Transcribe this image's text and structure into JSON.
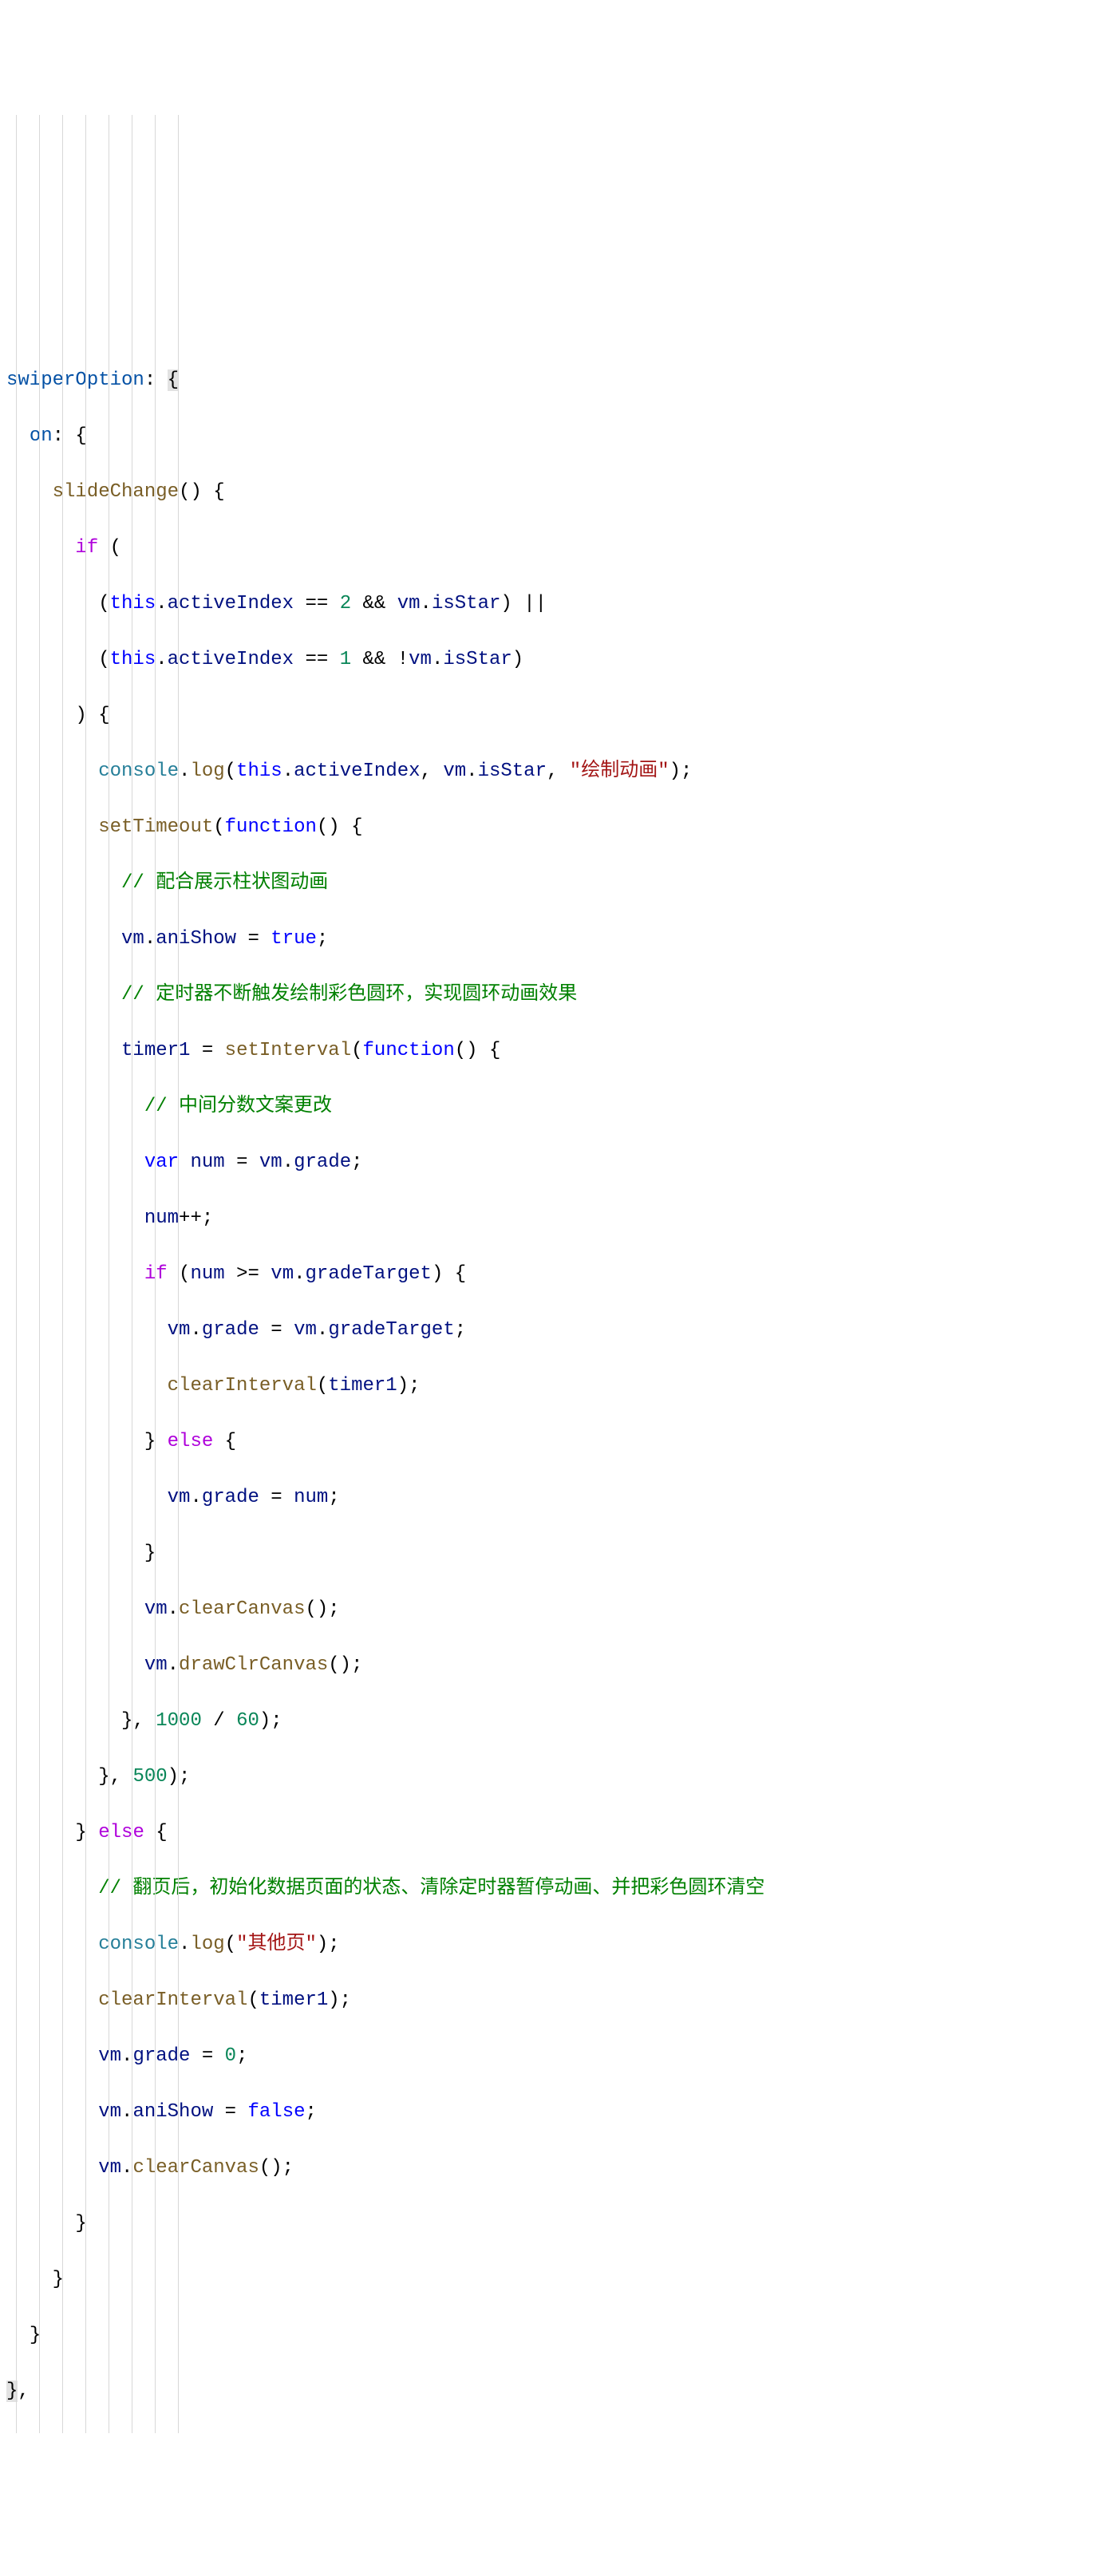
{
  "code": {
    "t_swiperOption": "swiperOption",
    "t_on": "on",
    "t_slideChange": "slideChange",
    "t_if": "if",
    "t_this1": "this",
    "t_activeIndex1": "activeIndex",
    "t_eq1": "==",
    "t_2": "2",
    "t_and1": "&&",
    "t_vm1": "vm",
    "t_isStar1": "isStar",
    "t_or": "||",
    "t_this2": "this",
    "t_activeIndex2": "activeIndex",
    "t_eq2": "==",
    "t_1": "1",
    "t_and2": "&&",
    "t_not": "!",
    "t_vm2": "vm",
    "t_isStar2": "isStar",
    "t_console1": "console",
    "t_log1": "log",
    "t_this3": "this",
    "t_activeIndex3": "activeIndex",
    "t_vm3": "vm",
    "t_isStar3": "isStar",
    "t_strDraw": "\"绘制动画\"",
    "t_setTimeout": "setTimeout",
    "t_function1": "function",
    "t_com1": "// 配合展示柱状图动画",
    "t_vm4": "vm",
    "t_aniShow1": "aniShow",
    "t_true": "true",
    "t_com2": "// 定时器不断触发绘制彩色圆环，实现圆环动画效果",
    "t_timer1a": "timer1",
    "t_setInterval": "setInterval",
    "t_function2": "function",
    "t_com3": "// 中间分数文案更改",
    "t_var": "var",
    "t_numDecl": "num",
    "t_vm5": "vm",
    "t_grade1": "grade",
    "t_numInc": "num",
    "t_pp": "++",
    "t_if2": "if",
    "t_num2": "num",
    "t_gte": ">=",
    "t_vm6": "vm",
    "t_gradeTarget1": "gradeTarget",
    "t_vm7": "vm",
    "t_grade2": "grade",
    "t_vm8": "vm",
    "t_gradeTarget2": "gradeTarget",
    "t_clearInterval1": "clearInterval",
    "t_timer1b": "timer1",
    "t_else1": "else",
    "t_vm9": "vm",
    "t_grade3": "grade",
    "t_num3": "num",
    "t_vm10": "vm",
    "t_clearCanvas1": "clearCanvas",
    "t_vm11": "vm",
    "t_drawClrCanvas": "drawClrCanvas",
    "t_1000": "1000",
    "t_div": "/",
    "t_60": "60",
    "t_500": "500",
    "t_else2": "else",
    "t_com4": "// 翻页后，初始化数据页面的状态、清除定时器暂停动画、并把彩色圆环清空",
    "t_console2": "console",
    "t_log2": "log",
    "t_strOther": "\"其他页\"",
    "t_clearInterval2": "clearInterval",
    "t_timer1c": "timer1",
    "t_vm12": "vm",
    "t_grade4": "grade",
    "t_0": "0",
    "t_vm13": "vm",
    "t_aniShow2": "aniShow",
    "t_false": "false",
    "t_vm14": "vm",
    "t_clearCanvas2": "clearCanvas"
  }
}
